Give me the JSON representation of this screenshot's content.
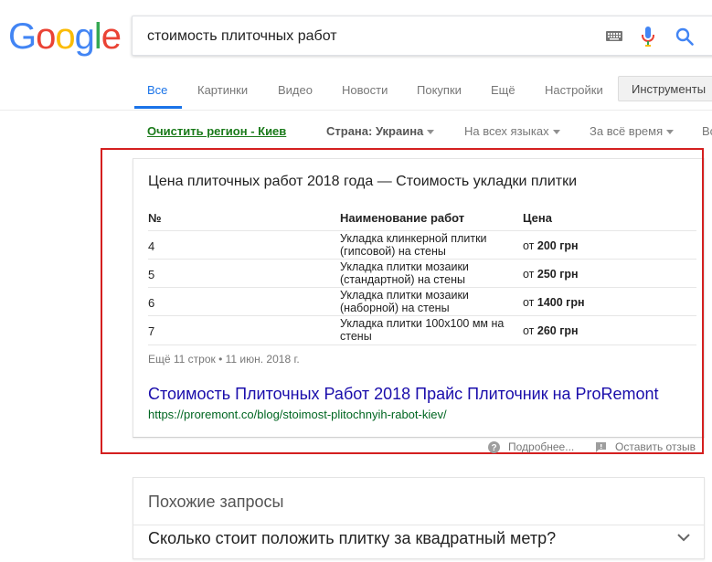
{
  "logo": {
    "letters": [
      "G",
      "o",
      "o",
      "g",
      "l",
      "e"
    ],
    "colors": [
      "#4285F4",
      "#EA4335",
      "#FBBC05",
      "#4285F4",
      "#34A853",
      "#EA4335"
    ]
  },
  "search": {
    "query": "стоимость плиточных работ"
  },
  "tabs": {
    "items": [
      "Все",
      "Картинки",
      "Видео",
      "Новости",
      "Покупки",
      "Ещё",
      "Настройки"
    ],
    "tools": "Инструменты",
    "active_color": "#1a73e8"
  },
  "filters": {
    "clear_region": "Очистить регион - Киев",
    "country": "Страна: Украина",
    "language": "На всех языках",
    "time": "За всё время",
    "extra": "Вс"
  },
  "snippet": {
    "title": "Цена плиточных работ 2018 года — Стоимость укладки плитки",
    "headers": [
      "№",
      "Наименование работ",
      "Цена"
    ],
    "rows": [
      {
        "num": "4",
        "name": "Укладка клинкерной плитки (гипсовой) на стены",
        "price_prefix": "от",
        "price": "200 грн"
      },
      {
        "num": "5",
        "name": "Укладка плитки мозаики (стандартной) на стены",
        "price_prefix": "от",
        "price": "250 грн"
      },
      {
        "num": "6",
        "name": "Укладка плитки мозаики (наборной) на стены",
        "price_prefix": "от",
        "price": "1400 грн"
      },
      {
        "num": "7",
        "name": "Укладка плитки 100х100 мм на стены",
        "price_prefix": "от",
        "price": "260 грн"
      }
    ],
    "more": "Ещё 11 строк • 11 июн. 2018 г.",
    "link": "Стоимость Плиточных Работ 2018 Прайс Плиточник на ProRemont",
    "url": "https://proremont.co/blog/stoimost-plitochnyih-rabot-kiev/"
  },
  "feedback": {
    "more": "Подробнее...",
    "feedback": "Оставить отзыв"
  },
  "related": {
    "title": "Похожие запросы",
    "question": "Сколько стоит положить плитку за квадратный метр?"
  }
}
